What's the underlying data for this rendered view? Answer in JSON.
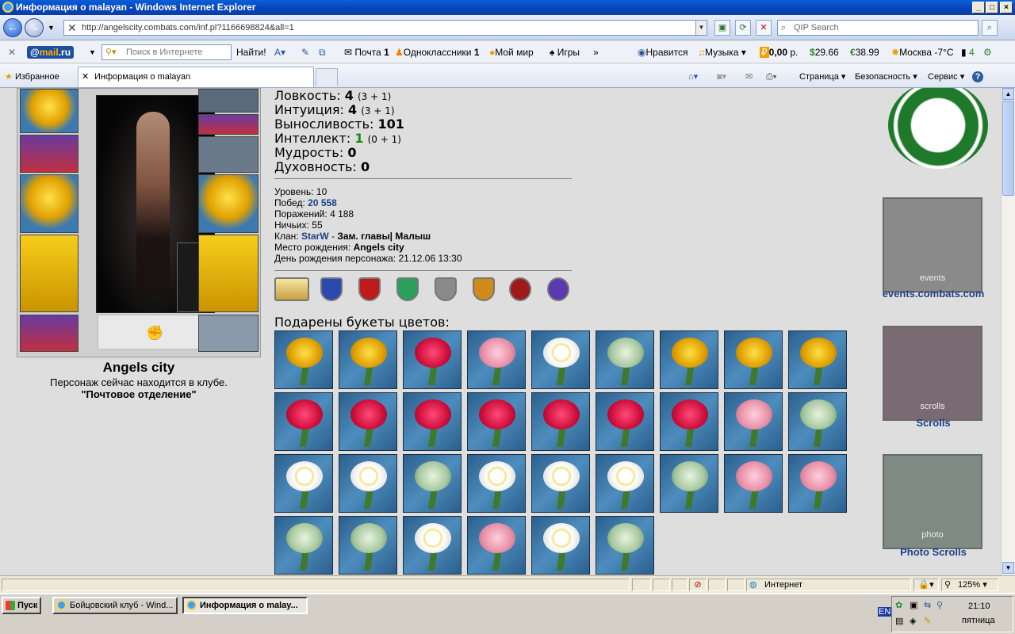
{
  "window": {
    "title": "Информация о malayan - Windows Internet Explorer"
  },
  "address": {
    "url": "http://angelscity.combats.com/inf.pl?1166698824&all=1",
    "search_placeholder": "QIP Search"
  },
  "mailbar": {
    "logo_prefix": "@",
    "logo_main": "mail",
    "logo_suffix": ".ru",
    "search_placeholder": "Поиск в Интернете",
    "find_label": "Найти!",
    "mail_label": "Почта",
    "mail_count": "1",
    "odnoklassniki_label": "Одноклассники",
    "odnoklassniki_count": "1",
    "moymir_label": "Мой мир",
    "games_label": "Игры",
    "like_label": "Нравится",
    "music_label": "Музыка",
    "balance": "0,00",
    "balance_unit": "р.",
    "usd": "29.66",
    "eur": "38.99",
    "weather": "Москва -7°C",
    "traffic": "4"
  },
  "favbar": {
    "favorites_label": "Избранное",
    "tab_title": "Информация о malayan",
    "page_menu": "Страница",
    "security_menu": "Безопасность",
    "service_menu": "Сервис"
  },
  "stats": [
    {
      "label": "Ловкость:",
      "value": "4",
      "extra": "(3 + 1)",
      "color": "#000000"
    },
    {
      "label": "Интуиция:",
      "value": "4",
      "extra": "(3 + 1)",
      "color": "#000000"
    },
    {
      "label": "Выносливость:",
      "value": "101",
      "extra": "",
      "color": "#000000"
    },
    {
      "label": "Интеллект:",
      "value": "1",
      "extra": "(0 + 1)",
      "color": "#1a8a1a"
    },
    {
      "label": "Мудрость:",
      "value": "0",
      "extra": "",
      "color": "#000000"
    },
    {
      "label": "Духовность:",
      "value": "0",
      "extra": "",
      "color": "#000000"
    }
  ],
  "info": {
    "level_label": "Уровень:",
    "level": "10",
    "wins_label": "Побед:",
    "wins": "20 558",
    "losses_label": "Поражений:",
    "losses": "4 188",
    "draws_label": "Ничьих:",
    "draws": "55",
    "clan_label": "Клан:",
    "clan": "StarW",
    "clan_rank": "Зам. главы| Малыш",
    "birthplace_label": "Место рождения:",
    "birthplace": "Angels city",
    "birthday_label": "День рождения персонажа:",
    "birthday": "21.12.06 13:30"
  },
  "character": {
    "city": "Angels city",
    "location_text": "Персонаж сейчас находится в клубе.",
    "location_place": "\"Почтовое отделение\""
  },
  "flowers": {
    "title": "Подарены букеты цветов:",
    "items": [
      "yellow",
      "yellow",
      "red",
      "pink",
      "white",
      "green",
      "yellow",
      "yellow",
      "yellow",
      "red",
      "red",
      "red",
      "red",
      "red",
      "red",
      "red",
      "pink",
      "green",
      "white",
      "white",
      "green",
      "white",
      "white",
      "white",
      "green",
      "pink",
      "pink",
      "green",
      "green",
      "white",
      "pink",
      "white",
      "green"
    ]
  },
  "sidebar": {
    "events_caption": "events",
    "events_link": "events.combats.com",
    "scrolls_caption": "scrolls",
    "scrolls_link": "Scrolls",
    "photo_caption": "photo",
    "photo_link": "Photo Scrolls"
  },
  "status": {
    "zone": "Интернет",
    "zoom": "125%"
  },
  "taskbar": {
    "start_label": "Пуск",
    "task1": "Бойцовский клуб - Wind...",
    "task2": "Информация о malay...",
    "lang": "EN",
    "time": "21:10",
    "day": "пятница"
  },
  "colors": {
    "link": "#1e3f86",
    "accent_green": "#1a8a1a",
    "page_bg": "#dedede"
  }
}
